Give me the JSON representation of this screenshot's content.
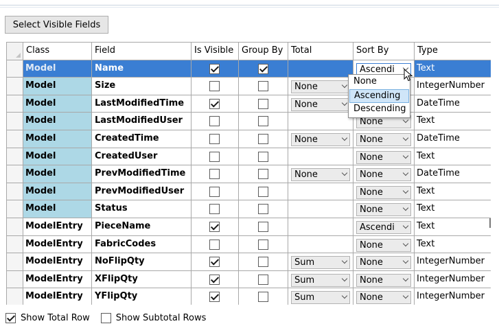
{
  "toolbar": {
    "select_fields_label": "Select Visible Fields"
  },
  "grid": {
    "columns": [
      "Class",
      "Field",
      "Is Visible",
      "Group By",
      "Total",
      "Sort By",
      "Type"
    ],
    "rows": [
      {
        "class": "Model",
        "field": "Name",
        "visible": true,
        "group": true,
        "total": "",
        "sort": "Ascendi",
        "type": "Text"
      },
      {
        "class": "Model",
        "field": "Size",
        "visible": false,
        "group": false,
        "total": "None",
        "sort": "",
        "type": "IntegerNumber"
      },
      {
        "class": "Model",
        "field": "LastModifiedTime",
        "visible": true,
        "group": false,
        "total": "None",
        "sort": "",
        "type": "DateTime"
      },
      {
        "class": "Model",
        "field": "LastModifiedUser",
        "visible": false,
        "group": false,
        "total": "",
        "sort": "None",
        "type": "Text"
      },
      {
        "class": "Model",
        "field": "CreatedTime",
        "visible": false,
        "group": false,
        "total": "None",
        "sort": "None",
        "type": "DateTime"
      },
      {
        "class": "Model",
        "field": "CreatedUser",
        "visible": false,
        "group": false,
        "total": "",
        "sort": "None",
        "type": "Text"
      },
      {
        "class": "Model",
        "field": "PrevModifiedTime",
        "visible": false,
        "group": false,
        "total": "None",
        "sort": "None",
        "type": "DateTime"
      },
      {
        "class": "Model",
        "field": "PrevModifiedUser",
        "visible": false,
        "group": false,
        "total": "",
        "sort": "None",
        "type": "Text"
      },
      {
        "class": "Model",
        "field": "Status",
        "visible": false,
        "group": false,
        "total": "",
        "sort": "None",
        "type": "Text"
      },
      {
        "class": "ModelEntry",
        "field": "PieceName",
        "visible": true,
        "group": false,
        "total": "",
        "sort": "Ascendi",
        "type": "Text"
      },
      {
        "class": "ModelEntry",
        "field": "FabricCodes",
        "visible": false,
        "group": false,
        "total": "",
        "sort": "None",
        "type": "Text"
      },
      {
        "class": "ModelEntry",
        "field": "NoFlipQty",
        "visible": true,
        "group": false,
        "total": "Sum",
        "sort": "None",
        "type": "IntegerNumber"
      },
      {
        "class": "ModelEntry",
        "field": "XFlipQty",
        "visible": true,
        "group": false,
        "total": "Sum",
        "sort": "None",
        "type": "IntegerNumber"
      },
      {
        "class": "ModelEntry",
        "field": "YFlipQty",
        "visible": true,
        "group": false,
        "total": "Sum",
        "sort": "None",
        "type": "IntegerNumber"
      }
    ]
  },
  "sort_dropdown": {
    "options": [
      "None",
      "Ascending",
      "Descending"
    ],
    "highlighted": "Ascending"
  },
  "footer": {
    "show_total_row": "Show Total Row",
    "show_total_row_checked": true,
    "show_subtotal_rows": "Show Subtotal Rows",
    "show_subtotal_rows_checked": false
  },
  "colors": {
    "selection": "#3a7ed3",
    "model_class_bg": "#add8e6",
    "dropdown_highlight": "#cfe5f8"
  }
}
